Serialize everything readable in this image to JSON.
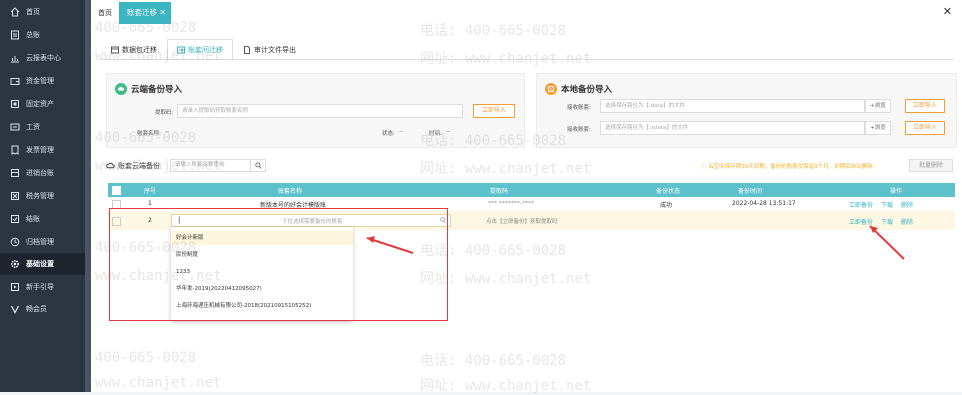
{
  "sidebar": {
    "items": [
      {
        "label": "首页",
        "icon": "home-icon"
      },
      {
        "label": "总账",
        "icon": "ledger-icon"
      },
      {
        "label": "云报表中心",
        "icon": "report-icon"
      },
      {
        "label": "资金管理",
        "icon": "wallet-icon"
      },
      {
        "label": "固定资产",
        "icon": "asset-icon"
      },
      {
        "label": "工资",
        "icon": "salary-icon"
      },
      {
        "label": "发票管理",
        "icon": "invoice-icon"
      },
      {
        "label": "进销台账",
        "icon": "inventory-icon"
      },
      {
        "label": "税务管理",
        "icon": "tax-icon"
      },
      {
        "label": "结账",
        "icon": "close-books-icon"
      },
      {
        "label": "归档管理",
        "icon": "archive-icon"
      },
      {
        "label": "基础设置",
        "icon": "gear-icon"
      },
      {
        "label": "新手引导",
        "icon": "guide-icon"
      },
      {
        "label": "畅会员",
        "icon": "vip-icon"
      }
    ],
    "active_index": 11
  },
  "topbar": {
    "home_tab": "首页",
    "active_tab": "账套迁移",
    "close_glyph": "✕",
    "window_close": "✕"
  },
  "subtabs": [
    "数据包迁移",
    "账套间迁移",
    "审计文件导出"
  ],
  "cloud_import": {
    "title": "云端备份导入",
    "code_label": "提取码:",
    "code_placeholder": "请录入提取码获取账套名称",
    "import_button": "立即导入",
    "account_name_label": "账套名称:",
    "account_name_value": "--",
    "status_label": "状态:",
    "status_value": "--",
    "time_label": "时间:",
    "time_value": "--"
  },
  "local_import": {
    "title": "本地备份导入",
    "row1_label": "接收账套:",
    "row1_placeholder": "选择保存路径为【.data】的文件",
    "row1_browse": "+浏览",
    "row1_button": "立即导入",
    "row2_label": "接收账套:",
    "row2_placeholder": "选择保存路径为【.xdata】的文件",
    "row2_browse": "+浏览",
    "row2_button": "立即导入"
  },
  "cloud_backup": {
    "label": "账套云端备份",
    "search_placeholder": "请输入账套名称查询",
    "notice": "ⓘ 云空间保存期30天到期，备份的账套仅保留9个月，到期后自动删除",
    "batch_delete": "批量删除"
  },
  "table": {
    "headers": [
      "",
      "序号",
      "账套名称",
      "提取码",
      "备份状态",
      "备份时间",
      "操作"
    ],
    "rows": [
      {
        "index": "1",
        "name": "新版本号的好会计模版账",
        "code": "*** *******-****",
        "status": "成功",
        "time": "2022-04-28 13:51:17",
        "actions": [
          "立即备份",
          "下载",
          "删除"
        ]
      },
      {
        "index": "2",
        "name_placeholder": "下拉选择需要备份的账套",
        "code_hint": "点击【立即备份】获取提取码",
        "status": "",
        "time": "",
        "actions": [
          "立即备份",
          "下载",
          "删除"
        ]
      }
    ]
  },
  "dropdown": {
    "options": [
      "好会计新版",
      "民份制度",
      "1233",
      "华年发-2019(20220412095027)",
      "上海环海递压机械有限公司-2018(20210915105252)"
    ],
    "highlighted_index": 0
  },
  "watermarks": {
    "phone": "400-665-0028",
    "phone_label": "电话: 400-665-0028",
    "site_label": "网址: www.chanjet.net",
    "site": "www.chanjet.net"
  },
  "colors": {
    "accent": "#3ab5c2",
    "orange": "#f29d38",
    "sidebar": "#2c3542",
    "alert": "#e23a3a"
  }
}
